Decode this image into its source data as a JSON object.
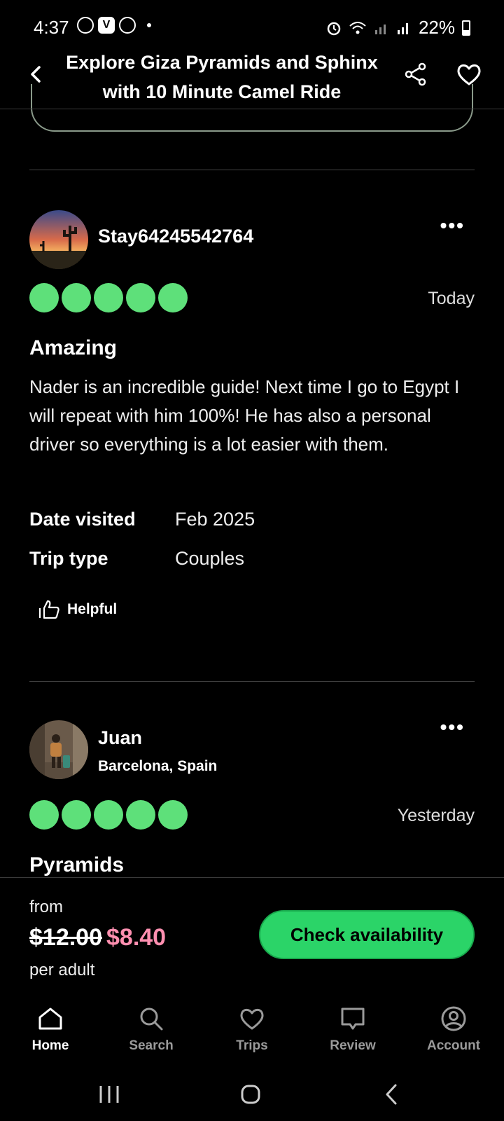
{
  "status": {
    "time": "4:37",
    "battery": "22%",
    "notif_badge": "V"
  },
  "header": {
    "title": "Explore Giza Pyramids and Sphinx with 10 Minute Camel Ride"
  },
  "reviews": [
    {
      "user": "Stay64245542764",
      "location": "",
      "rating": 5,
      "date": "Today",
      "title": "Amazing",
      "body": "Nader is an incredible guide! Next time I go to Egypt I will repeat with him 100%! He has also a personal driver so everything is a lot easier with them.",
      "date_visited_label": "Date visited",
      "date_visited": "Feb 2025",
      "trip_type_label": "Trip type",
      "trip_type": "Couples",
      "helpful_label": "Helpful",
      "more": "•••"
    },
    {
      "user": "Juan",
      "location": "Barcelona, Spain",
      "rating": 5,
      "date": "Yesterday",
      "title": "Pyramids",
      "more": "•••"
    }
  ],
  "booking": {
    "from_label": "from",
    "old_price": "$12.00",
    "new_price": "$8.40",
    "per_label": "per adult",
    "cta": "Check availability"
  },
  "nav": [
    {
      "label": "Home",
      "icon": "home-icon"
    },
    {
      "label": "Search",
      "icon": "search-icon"
    },
    {
      "label": "Trips",
      "icon": "heart-icon"
    },
    {
      "label": "Review",
      "icon": "review-icon"
    },
    {
      "label": "Account",
      "icon": "account-icon"
    }
  ],
  "colors": {
    "bubble": "#5ee07a",
    "cta": "#2bd468",
    "sale_price": "#ff8fb0"
  }
}
